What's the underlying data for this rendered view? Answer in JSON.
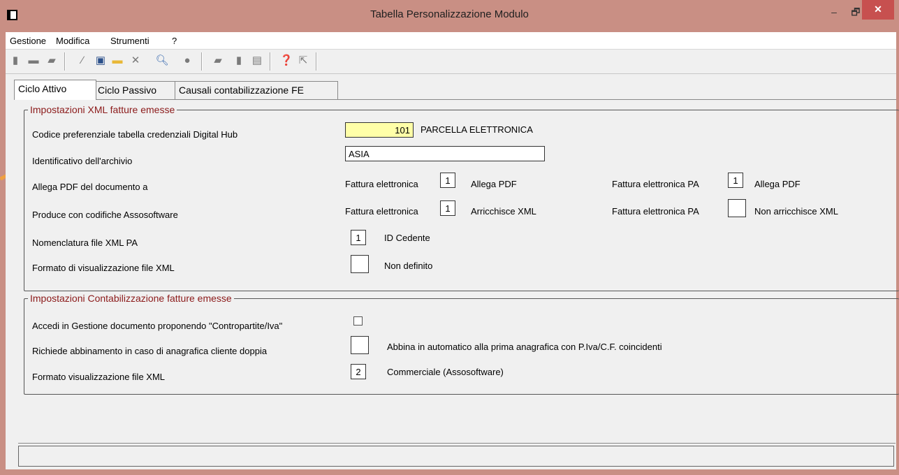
{
  "window": {
    "title": "Tabella Personalizzazione Modulo",
    "minimize": "–",
    "maximize": "🗗",
    "close": "✕"
  },
  "menu": [
    "Gestione",
    "Modifica",
    "Strumenti",
    "?"
  ],
  "tabs": [
    "Ciclo Attivo",
    "Ciclo Passivo",
    "Causali contabilizzazione FE"
  ],
  "xml": {
    "legend": "Impostazioni XML fatture emesse",
    "codice_label": "Codice preferenziale tabella credenziali Digital Hub",
    "codice_value": "101",
    "codice_desc": "PARCELLA ELETTRONICA",
    "archivio_label": "Identificativo dell'archivio",
    "archivio_value": "ASIA",
    "allega_label": "Allega PDF del documento a",
    "fe_label": "Fattura elettronica",
    "fepa_label": "Fattura elettronica PA",
    "allega_fe_value": "1",
    "allega_fe_desc": "Allega PDF",
    "allega_fepa_value": "1",
    "allega_fepa_desc": "Allega PDF",
    "produce_label": "Produce con codifiche Assosoftware",
    "produce_fe_value": "1",
    "produce_fe_desc": "Arricchisce XML",
    "produce_fepa_value": "",
    "produce_fepa_desc": "Non arricchisce XML",
    "nomencl_label": "Nomenclatura file XML PA",
    "nomencl_value": "1",
    "nomencl_desc": "ID Cedente",
    "formato_label": "Formato di visualizzazione file XML",
    "formato_value": "",
    "formato_desc": "Non definito"
  },
  "contab": {
    "legend": "Impostazioni Contabilizzazione fatture emesse",
    "accedi_label": "Accedi in Gestione documento proponendo \"Contropartite/Iva\"",
    "richiede_label": "Richiede abbinamento in caso di anagrafica cliente doppia",
    "richiede_value": "",
    "richiede_desc": "Abbina in automatico alla prima anagrafica con P.Iva/C.F. coincidenti",
    "formato_label": "Formato visualizzazione file XML",
    "formato_value": "2",
    "formato_desc": "Commerciale (Assosoftware)"
  },
  "colors": {
    "accent": "#8b1a1a",
    "frame": "#c98f84",
    "highlight": "#ffffa8",
    "close": "#c7504f"
  }
}
